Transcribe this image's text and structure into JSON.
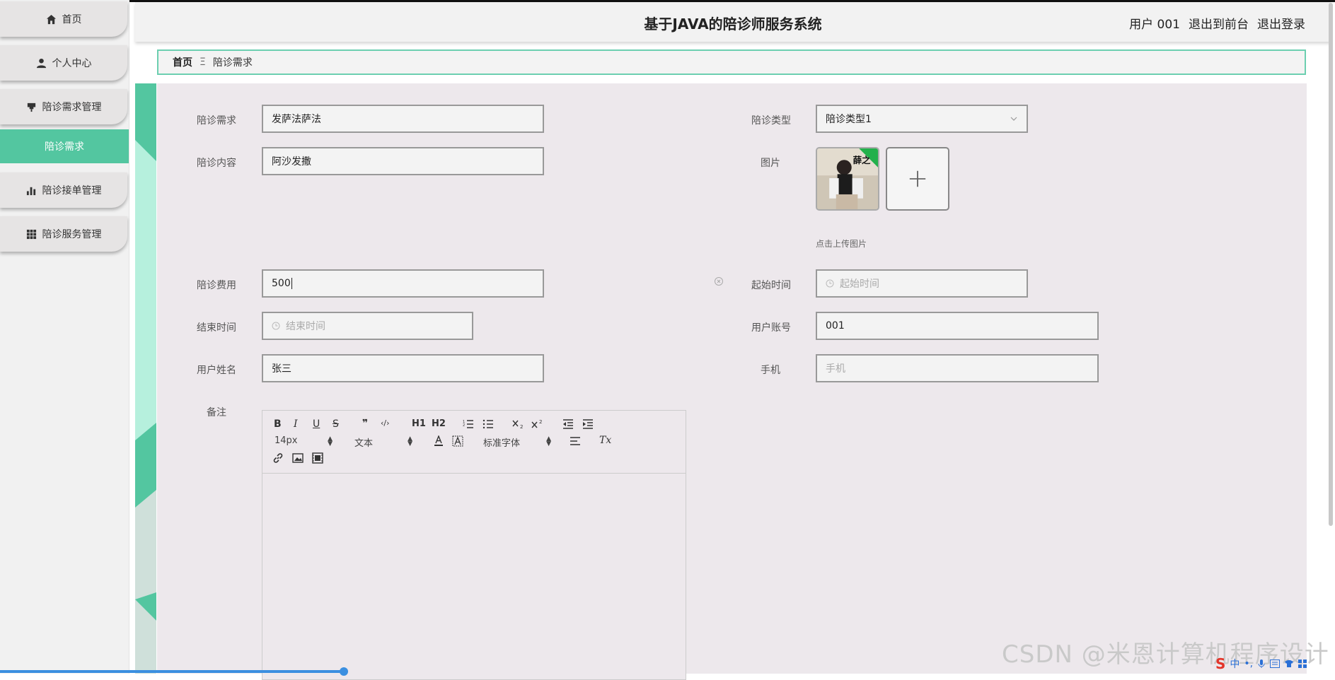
{
  "header": {
    "title": "基于JAVA的陪诊师服务系统",
    "user": "用户 001",
    "front_link": "退出到前台",
    "logout_link": "退出登录"
  },
  "sidebar": {
    "items": [
      {
        "label": "首页",
        "icon": "home-icon"
      },
      {
        "label": "个人中心",
        "icon": "user-icon"
      },
      {
        "label": "陪诊需求管理",
        "icon": "pin-icon"
      },
      {
        "label": "陪诊接单管理",
        "icon": "bar-chart-icon"
      },
      {
        "label": "陪诊服务管理",
        "icon": "grid-icon"
      }
    ],
    "sub_active": "陪诊需求"
  },
  "breadcrumb": {
    "home": "首页",
    "separator": "Ξ",
    "current": "陪诊需求"
  },
  "form": {
    "need_label": "陪诊需求",
    "need_value": "发萨法萨法",
    "type_label": "陪诊类型",
    "type_value": "陪诊类型1",
    "content_label": "陪诊内容",
    "content_value": "阿沙发撒",
    "image_label": "图片",
    "upload_tip": "点击上传图片",
    "thumb_text": "薛之",
    "fee_label": "陪诊费用",
    "fee_value": "500",
    "start_label": "起始时间",
    "start_placeholder": "起始时间",
    "end_label": "结束时间",
    "end_placeholder": "结束时间",
    "account_label": "用户账号",
    "account_value": "001",
    "name_label": "用户姓名",
    "name_value": "张三",
    "phone_label": "手机",
    "phone_placeholder": "手机",
    "remark_label": "备注"
  },
  "editor": {
    "bold": "B",
    "italic": "I",
    "underline": "U",
    "strike": "S",
    "quote": "❞",
    "code": "‹/›",
    "h1": "H1",
    "h2": "H2",
    "size": "14px",
    "format": "文本",
    "font": "标准字体",
    "clear": "Tx"
  },
  "watermark": "CSDN @米恩计算机程序设计",
  "ime": {
    "mode": "中"
  },
  "colors": {
    "accent": "#53c6a0",
    "panel": "#ede8ec",
    "sidebar": "#f1f1f1"
  }
}
